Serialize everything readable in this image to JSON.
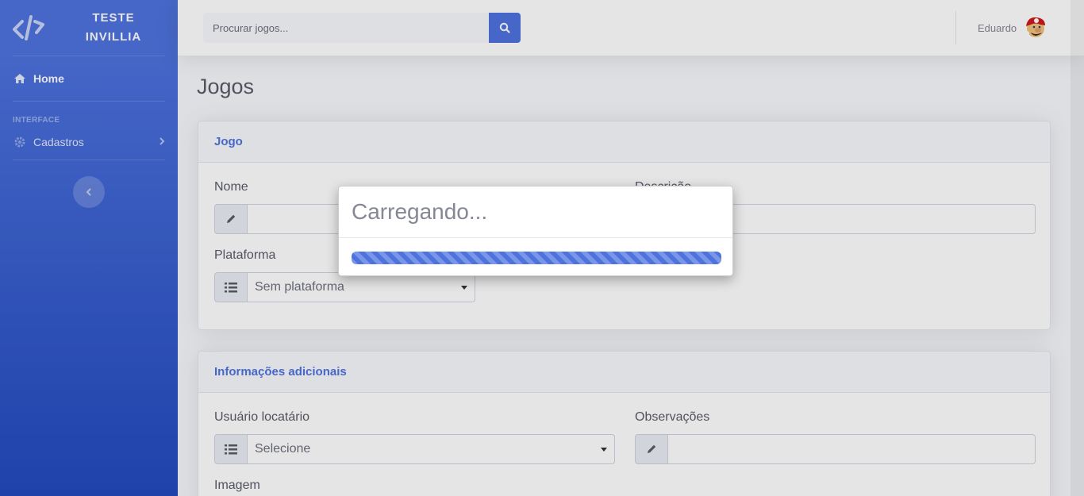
{
  "sidebar": {
    "brand_line1": "TESTE",
    "brand_line2": "INVILLIA",
    "home_label": "Home",
    "heading": "INTERFACE",
    "cadastros_label": "Cadastros"
  },
  "topbar": {
    "search_placeholder": "Procurar jogos...",
    "user_name": "Eduardo"
  },
  "page": {
    "title": "Jogos"
  },
  "card_jogo": {
    "header": "Jogo",
    "nome_label": "Nome",
    "nome_value": "",
    "descricao_label": "Descrição",
    "descricao_value": "",
    "plataforma_label": "Plataforma",
    "plataforma_value": "Sem plataforma"
  },
  "card_info": {
    "header": "Informações adicionais",
    "usuario_label": "Usuário locatário",
    "usuario_value": "Selecione",
    "observacoes_label": "Observações",
    "observacoes_value": "",
    "imagem_label": "Imagem"
  },
  "modal": {
    "title": "Carregando...",
    "progress_fraction": 1.0
  },
  "colors": {
    "primary": "#4e73df",
    "sidebar_dark": "#224abe"
  },
  "icons": {
    "brand": "code-logo-icon",
    "home": "home-icon",
    "cadastros": "gear-icon",
    "chevron": "chevron-right-icon",
    "toggler": "chevron-left-icon",
    "search": "search-icon",
    "pencil": "pencil-icon",
    "list": "list-icon",
    "avatar": "mario-avatar"
  }
}
